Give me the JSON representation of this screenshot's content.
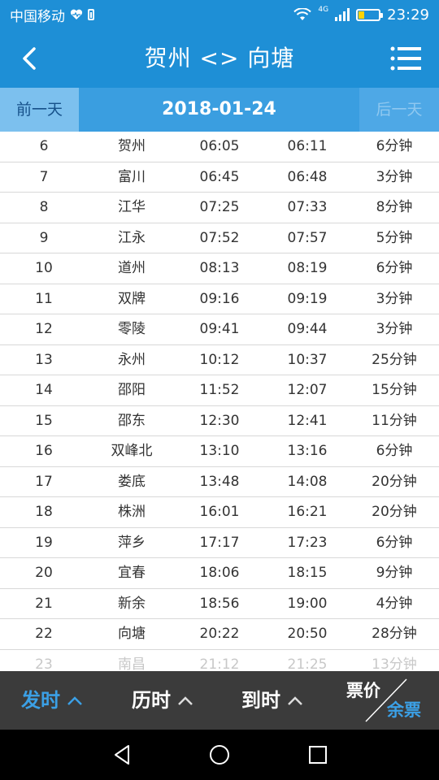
{
  "status_bar": {
    "carrier": "中国移动",
    "time": "23:29",
    "network_label": "4G",
    "icons": [
      "heart-icon",
      "battery-alert-icon",
      "wifi-icon",
      "signal-icon",
      "battery-icon"
    ]
  },
  "header": {
    "title": "贺州 <> 向塘",
    "back_icon": "chevron-left-icon",
    "menu_icon": "hamburger-menu-icon"
  },
  "date_bar": {
    "prev_label": "前一天",
    "date": "2018-01-24",
    "next_label": "后一天"
  },
  "stops": [
    {
      "no": "6",
      "station": "贺州",
      "arrive": "06:05",
      "depart": "06:11",
      "stay": "6分钟"
    },
    {
      "no": "7",
      "station": "富川",
      "arrive": "06:45",
      "depart": "06:48",
      "stay": "3分钟"
    },
    {
      "no": "8",
      "station": "江华",
      "arrive": "07:25",
      "depart": "07:33",
      "stay": "8分钟"
    },
    {
      "no": "9",
      "station": "江永",
      "arrive": "07:52",
      "depart": "07:57",
      "stay": "5分钟"
    },
    {
      "no": "10",
      "station": "道州",
      "arrive": "08:13",
      "depart": "08:19",
      "stay": "6分钟"
    },
    {
      "no": "11",
      "station": "双牌",
      "arrive": "09:16",
      "depart": "09:19",
      "stay": "3分钟"
    },
    {
      "no": "12",
      "station": "零陵",
      "arrive": "09:41",
      "depart": "09:44",
      "stay": "3分钟"
    },
    {
      "no": "13",
      "station": "永州",
      "arrive": "10:12",
      "depart": "10:37",
      "stay": "25分钟"
    },
    {
      "no": "14",
      "station": "邵阳",
      "arrive": "11:52",
      "depart": "12:07",
      "stay": "15分钟"
    },
    {
      "no": "15",
      "station": "邵东",
      "arrive": "12:30",
      "depart": "12:41",
      "stay": "11分钟"
    },
    {
      "no": "16",
      "station": "双峰北",
      "arrive": "13:10",
      "depart": "13:16",
      "stay": "6分钟"
    },
    {
      "no": "17",
      "station": "娄底",
      "arrive": "13:48",
      "depart": "14:08",
      "stay": "20分钟"
    },
    {
      "no": "18",
      "station": "株洲",
      "arrive": "16:01",
      "depart": "16:21",
      "stay": "20分钟"
    },
    {
      "no": "19",
      "station": "萍乡",
      "arrive": "17:17",
      "depart": "17:23",
      "stay": "6分钟"
    },
    {
      "no": "20",
      "station": "宜春",
      "arrive": "18:06",
      "depart": "18:15",
      "stay": "9分钟"
    },
    {
      "no": "21",
      "station": "新余",
      "arrive": "18:56",
      "depart": "19:00",
      "stay": "4分钟"
    },
    {
      "no": "22",
      "station": "向塘",
      "arrive": "20:22",
      "depart": "20:50",
      "stay": "28分钟"
    },
    {
      "no": "23",
      "station": "南昌",
      "arrive": "21:12",
      "depart": "21:25",
      "stay": "13分钟"
    }
  ],
  "bottom_bar": {
    "sort_depart": "发时",
    "sort_duration": "历时",
    "sort_arrive": "到时",
    "price_label": "票价",
    "remaining_label": "余票",
    "active_color": "#3ba0e6"
  },
  "nav_bar": {
    "icons": [
      "triangle-back-icon",
      "circle-home-icon",
      "square-recent-icon"
    ]
  },
  "colors": {
    "primary": "#1e8fd6",
    "datebar": "#3a9ee0",
    "bottom_bg": "#3b3b3b"
  }
}
